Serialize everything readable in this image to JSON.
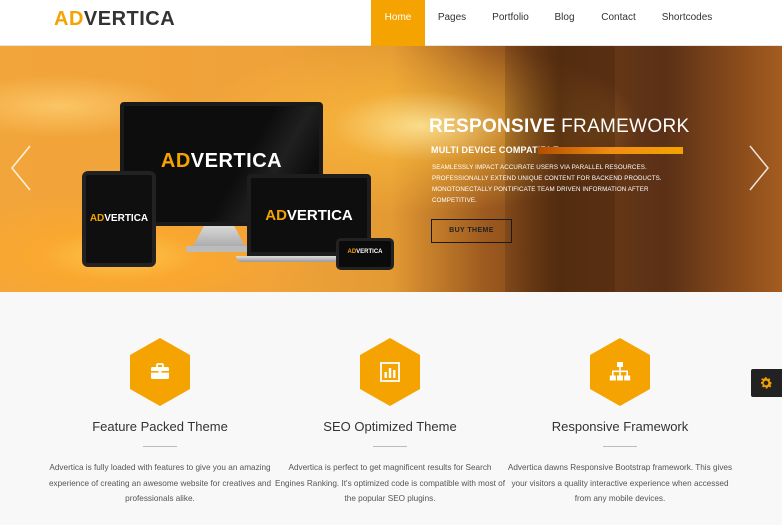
{
  "brand": {
    "logo_accent": "AD",
    "logo_rest": "VERTICA",
    "accent_color": "#f5a300"
  },
  "nav": {
    "items": [
      {
        "label": "Home",
        "active": true
      },
      {
        "label": "Pages",
        "active": false
      },
      {
        "label": "Portfolio",
        "active": false
      },
      {
        "label": "Blog",
        "active": false
      },
      {
        "label": "Contact",
        "active": false
      },
      {
        "label": "Shortcodes",
        "active": false
      }
    ]
  },
  "slider": {
    "title_strong": "RESPONSIVE",
    "title_rest": "FRAMEWORK",
    "subtitle": "MULTI DEVICE COMPATIBLE",
    "description": "SEAMLESSLY IMPACT ACCURATE USERS VIA PARALLEL RESOURCES. PROFESSIONALLY EXTEND UNIQUE CONTENT FOR BACKEND PRODUCTS. MONOTONECTALLY PONTIFICATE TEAM DRIVEN INFORMATION AFTER COMPETITIVE.",
    "button_label": "BUY THEME",
    "prev_icon": "chevron-left-icon",
    "next_icon": "chevron-right-icon"
  },
  "features": [
    {
      "icon": "briefcase-icon",
      "title": "Feature Packed Theme",
      "text": "Advertica is fully loaded with features to give you an amazing experience of creating an awesome website for creatives and professionals alike."
    },
    {
      "icon": "bar-chart-icon",
      "title": "SEO Optimized Theme",
      "text": "Advertica is perfect to get magnificent results for Search Engines Ranking. It's optimized code is compatible with most of the popular SEO plugins."
    },
    {
      "icon": "sitemap-icon",
      "title": "Responsive Framework",
      "text": "Advertica dawns Responsive Bootstrap framework. This gives your visitors a quality interactive experience when accessed from any mobile devices."
    }
  ],
  "settings_widget": {
    "icon": "gear-icon"
  }
}
